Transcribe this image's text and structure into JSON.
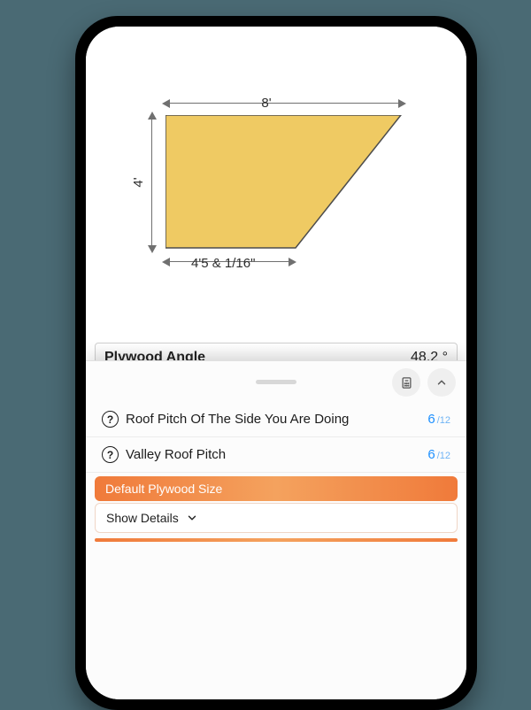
{
  "diagram": {
    "width_label": "8'",
    "height_label": "4'",
    "bottom_label": "4'5 & 1/16\""
  },
  "result": {
    "label": "Plywood Angle",
    "value": "48.2 °"
  },
  "rows": [
    {
      "label": "Roof Pitch Of The Side You Are Doing",
      "value": "6",
      "denom": "/12"
    },
    {
      "label": "Valley Roof Pitch",
      "value": "6",
      "denom": "/12"
    }
  ],
  "section": {
    "title": "Default Plywood Size",
    "details": "Show Details"
  },
  "chart_data": {
    "type": "diagram",
    "shape": "right-trapezoid",
    "top_width_ft": 8,
    "left_height_ft": 4,
    "bottom_width_ft_in": "4 ft 5 1/16 in",
    "angle_deg": 48.2
  }
}
